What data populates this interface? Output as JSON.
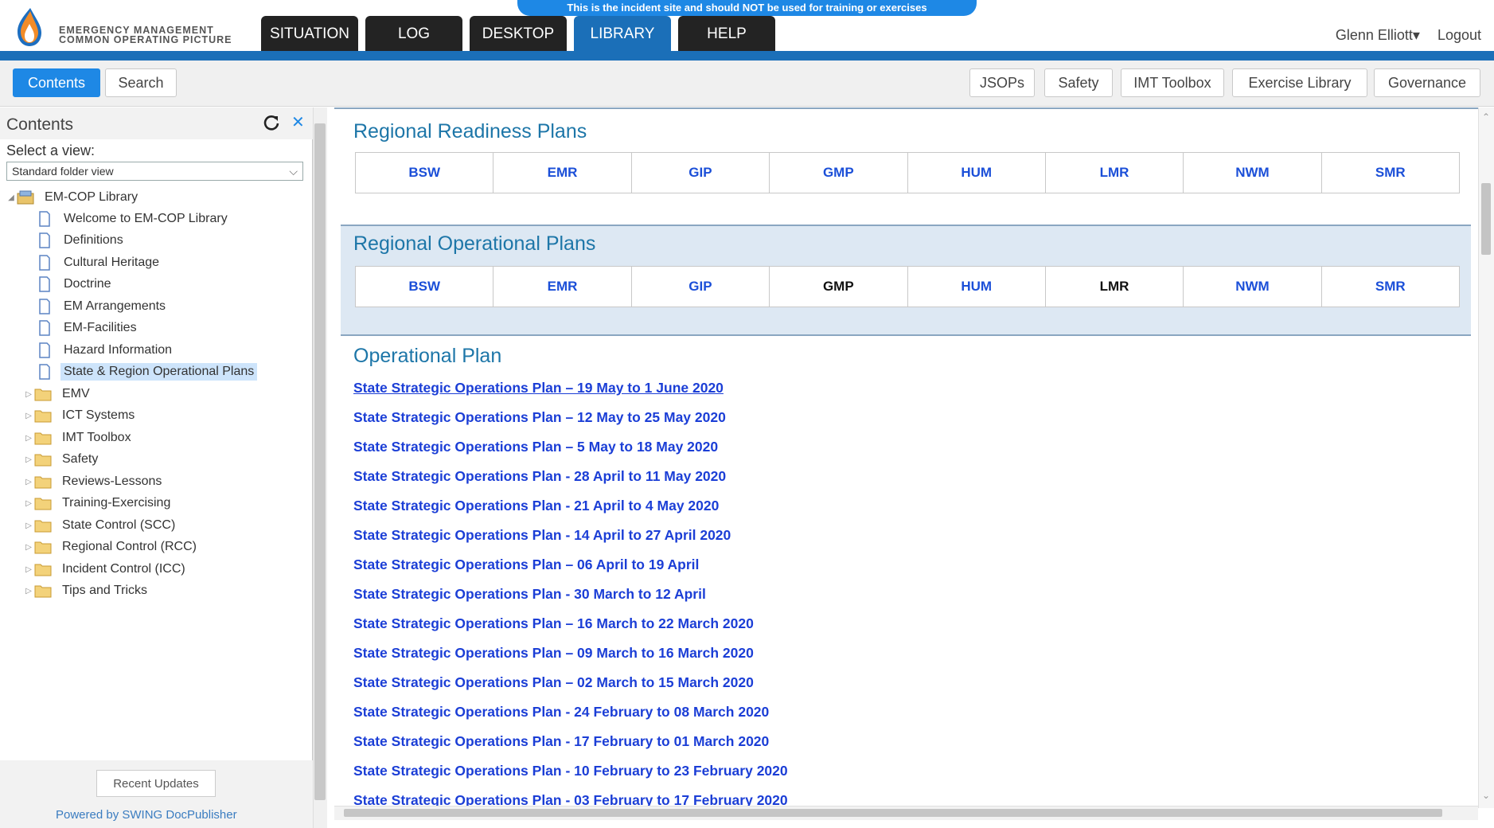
{
  "header": {
    "brand_line1": "EMERGENCY MANAGEMENT",
    "brand_line2": "COMMON OPERATING PICTURE",
    "banner": "This is the incident site and should NOT be used for training or exercises",
    "tabs": [
      "SITUATION",
      "LOG",
      "DESKTOP",
      "LIBRARY",
      "HELP"
    ],
    "user": "Glenn Elliott▾",
    "logout": "Logout"
  },
  "toolbar": {
    "left": [
      "Contents",
      "Search"
    ],
    "right": [
      "JSOPs",
      "Safety",
      "IMT Toolbox",
      "Exercise Library",
      "Governance"
    ]
  },
  "sidebar": {
    "title": "Contents",
    "select_label": "Select a view:",
    "select_value": "Standard folder view",
    "tree": [
      {
        "label": "EM-COP Library",
        "type": "root"
      },
      {
        "label": "Welcome to EM-COP Library",
        "type": "page"
      },
      {
        "label": "Definitions",
        "type": "page"
      },
      {
        "label": "Cultural Heritage",
        "type": "page"
      },
      {
        "label": "Doctrine",
        "type": "page"
      },
      {
        "label": "EM Arrangements",
        "type": "page"
      },
      {
        "label": "EM-Facilities",
        "type": "page"
      },
      {
        "label": "Hazard Information",
        "type": "page"
      },
      {
        "label": "State & Region Operational Plans",
        "type": "page",
        "selected": true
      },
      {
        "label": "EMV",
        "type": "folder"
      },
      {
        "label": "ICT Systems",
        "type": "folder"
      },
      {
        "label": "IMT Toolbox",
        "type": "folder"
      },
      {
        "label": "Safety",
        "type": "folder"
      },
      {
        "label": "Reviews-Lessons",
        "type": "folder"
      },
      {
        "label": "Training-Exercising",
        "type": "folder"
      },
      {
        "label": "State Control (SCC)",
        "type": "folder"
      },
      {
        "label": "Regional Control (RCC)",
        "type": "folder"
      },
      {
        "label": "Incident Control (ICC)",
        "type": "folder"
      },
      {
        "label": "Tips and Tricks",
        "type": "folder"
      }
    ],
    "recent_updates": "Recent Updates",
    "powered_by": "Powered by SWING DocPublisher"
  },
  "main": {
    "readiness": {
      "title": "Regional Readiness Plans",
      "regions": [
        "BSW",
        "EMR",
        "GIP",
        "GMP",
        "HUM",
        "LMR",
        "NWM",
        "SMR"
      ]
    },
    "operational": {
      "title": "Regional Operational Plans",
      "regions": [
        "BSW",
        "EMR",
        "GIP",
        "GMP",
        "HUM",
        "LMR",
        "NWM",
        "SMR"
      ],
      "black_regions": [
        "GMP",
        "LMR"
      ]
    },
    "operational_plan": {
      "title": "Operational Plan",
      "links": [
        "State Strategic Operations Plan – 19 May to 1 June 2020",
        "State Strategic Operations Plan – 12 May to 25 May 2020",
        "State Strategic Operations Plan – 5 May to 18 May 2020",
        "State Strategic Operations Plan - 28 April to 11 May 2020",
        "State Strategic Operations Plan - 21 April to 4 May 2020",
        "State Strategic Operations Plan - 14 April to 27 April 2020",
        "State Strategic Operations Plan – 06 April to 19 April",
        "State Strategic Operations Plan - 30 March to 12 April",
        "State Strategic Operations Plan – 16 March to 22 March 2020",
        "State Strategic Operations Plan – 09 March to 16 March 2020",
        "State Strategic Operations Plan – 02 March to 15 March 2020",
        "State Strategic Operations Plan - 24 February to 08 March 2020",
        "State Strategic Operations Plan - 17 February to 01 March 2020",
        "State Strategic Operations Plan - 10 February to 23 February 2020",
        "State Strategic Operations Plan - 03 February to 17 February 2020"
      ]
    }
  },
  "colors": {
    "accent": "#1b6fb8",
    "active_button": "#1e88e5",
    "link": "#1b3ed6",
    "section_title": "#1d76a8"
  }
}
